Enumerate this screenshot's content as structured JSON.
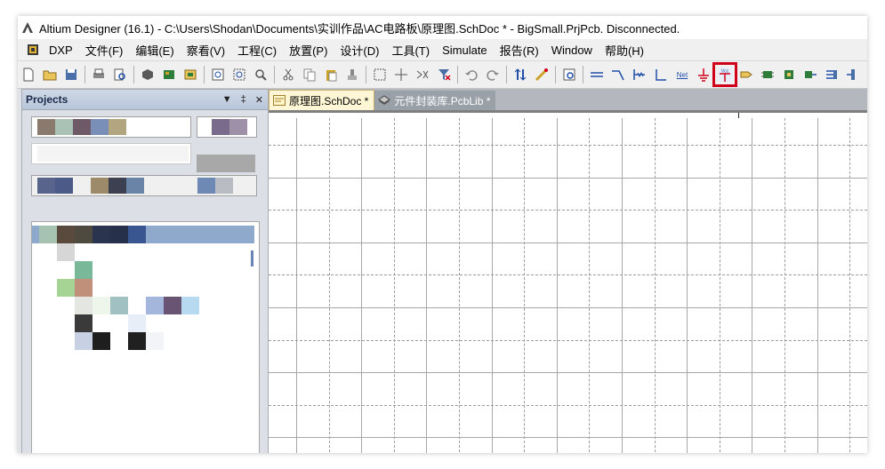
{
  "window": {
    "title": "Altium Designer (16.1) - C:\\Users\\Shodan\\Documents\\实训作品\\AC电路板\\原理图.SchDoc * - BigSmall.PrjPcb. Disconnected."
  },
  "menubar": {
    "items": [
      "DXP",
      "文件(F)",
      "编辑(E)",
      "察看(V)",
      "工程(C)",
      "放置(P)",
      "设计(D)",
      "工具(T)",
      "Simulate",
      "报告(R)",
      "Window",
      "帮助(H)"
    ]
  },
  "toolbar": {
    "net_label": "Net",
    "vcc_label": "Vcc",
    "highlight_color": "#d0021b"
  },
  "projects_panel": {
    "title": "Projects",
    "pin_glyph": "▼",
    "dock_glyph": "‡",
    "close_glyph": "✕"
  },
  "documents": {
    "tabs": [
      {
        "label": "原理图.SchDoc *",
        "active": true
      },
      {
        "label": "元件封装库.PcbLib *",
        "active": false
      }
    ]
  },
  "colors": {
    "accent": "#d0021b",
    "panel_header": "#b9c6da",
    "sheet_bg": "#ffffff"
  }
}
